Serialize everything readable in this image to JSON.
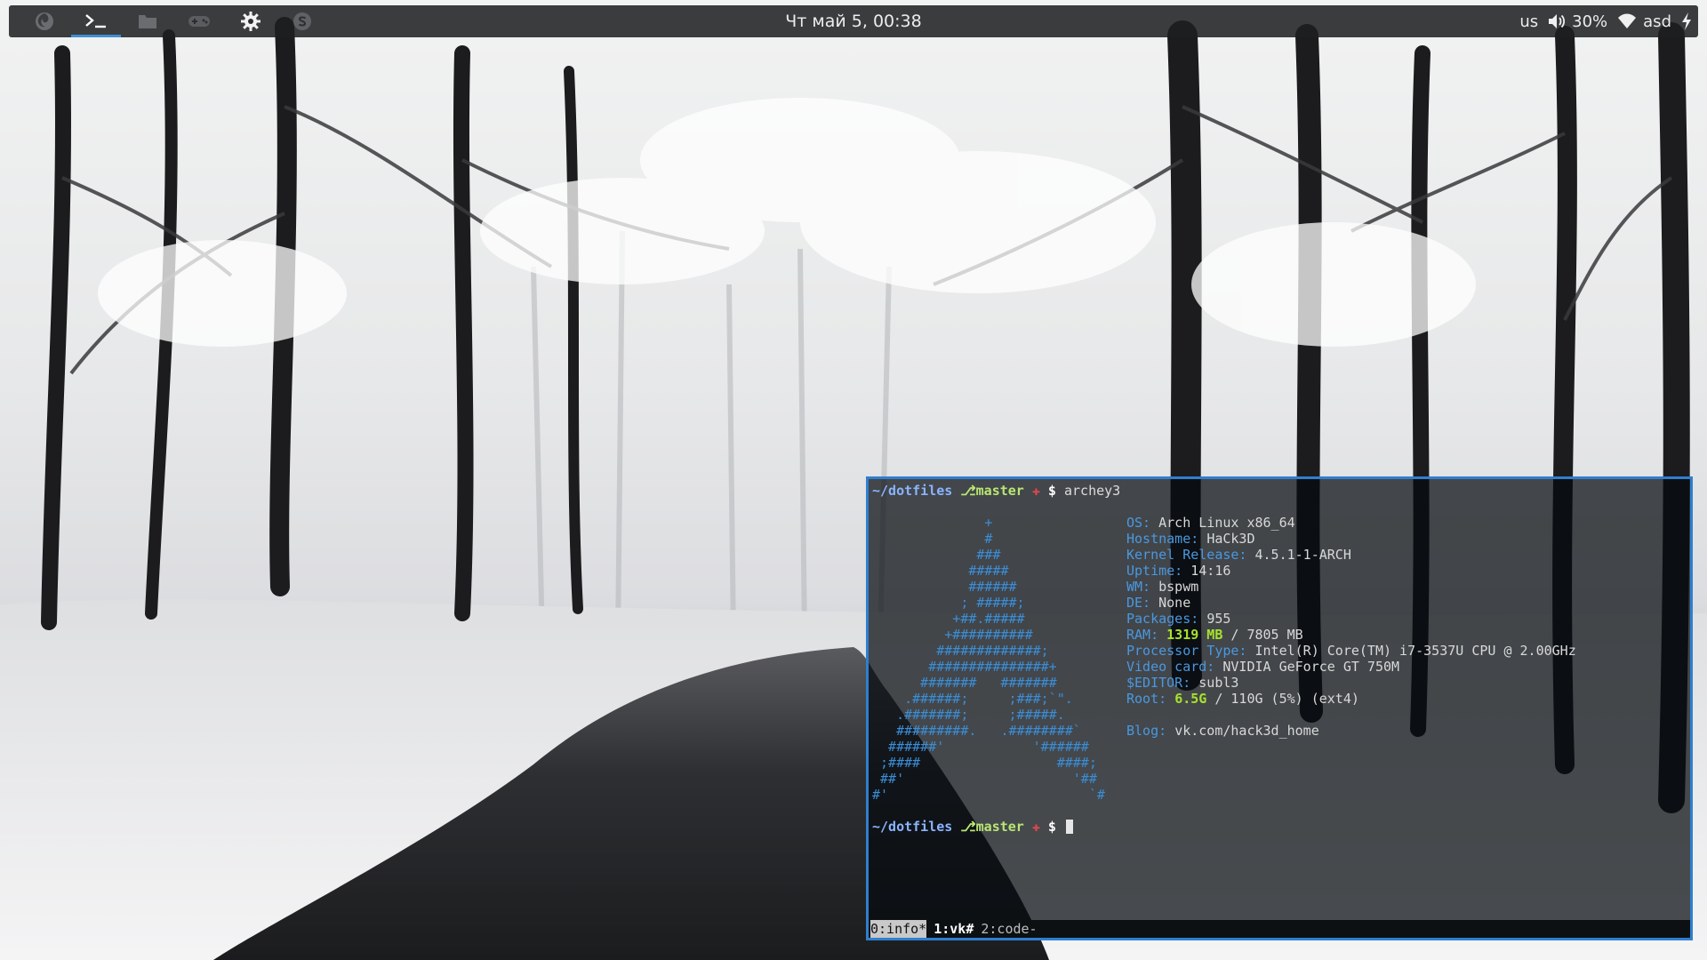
{
  "panel": {
    "launchers": [
      {
        "name": "browser-launcher",
        "icon": "firefox-icon",
        "active": false
      },
      {
        "name": "terminal-launcher",
        "icon": "terminal-icon",
        "active": true
      },
      {
        "name": "file-manager-launcher",
        "icon": "folder-icon",
        "active": false
      },
      {
        "name": "games-launcher",
        "icon": "gamepad-icon",
        "active": false
      },
      {
        "name": "settings-launcher",
        "icon": "gear-icon",
        "active": false
      },
      {
        "name": "skype-launcher",
        "icon": "skype-icon",
        "active": false
      }
    ],
    "clock": "Чт май  5, 00:38",
    "tray": {
      "keyboard_layout": "us",
      "volume_icon": "speaker-icon",
      "volume_percent": "30%",
      "wifi_icon": "wifi-icon",
      "network_name": "asd",
      "power_icon": "lightning-icon"
    },
    "colors": {
      "accent": "#3f8fd2",
      "background": "#1c1e21"
    }
  },
  "terminal": {
    "border_color": "#2f7fcf",
    "prompt": {
      "path": "~/dotfiles",
      "branch": "⎇master",
      "dirty": "✚",
      "symbol": "$"
    },
    "command": "archey3",
    "ascii_logo": [
      "              +",
      "              #",
      "             ###",
      "            #####",
      "            ######",
      "           ; #####;",
      "          +##.#####",
      "         +##########",
      "        #############;",
      "       ###############+",
      "      #######   #######",
      "    .######;     ;###;`\".",
      "   .#######;     ;#####.",
      "   #########.   .########`",
      "  ######'           '######",
      " ;####                 ####;",
      " ##'                     '##",
      "#'                         `#"
    ],
    "sysinfo": [
      {
        "key": "OS:",
        "value": "Arch Linux x86_64"
      },
      {
        "key": "Hostname:",
        "value": "HaCk3D"
      },
      {
        "key": "Kernel Release:",
        "value": "4.5.1-1-ARCH"
      },
      {
        "key": "Uptime:",
        "value": "14:16"
      },
      {
        "key": "WM:",
        "value": "bspwm"
      },
      {
        "key": "DE:",
        "value": "None"
      },
      {
        "key": "Packages:",
        "value": "955"
      },
      {
        "key": "RAM:",
        "value_hl": "1319 MB",
        "value": "/ 7805 MB"
      },
      {
        "key": "Processor Type:",
        "value": "Intel(R) Core(TM) i7-3537U CPU @ 2.00GHz"
      },
      {
        "key": "Video card:",
        "value": "NVIDIA GeForce GT 750M"
      },
      {
        "key": "$EDITOR:",
        "value": "subl3"
      },
      {
        "key": "Root:",
        "value_hl": "6.5G",
        "value": "/ 110G (5%) (ext4)"
      },
      {
        "key": "",
        "value": ""
      },
      {
        "key": "Blog:",
        "value": "vk.com/hack3d_home"
      }
    ],
    "tmux": {
      "windows": [
        {
          "label": "0:info*",
          "state": "current"
        },
        {
          "label": "1:vk#",
          "state": "bold"
        },
        {
          "label": "2:code-",
          "state": "dim"
        }
      ]
    }
  }
}
